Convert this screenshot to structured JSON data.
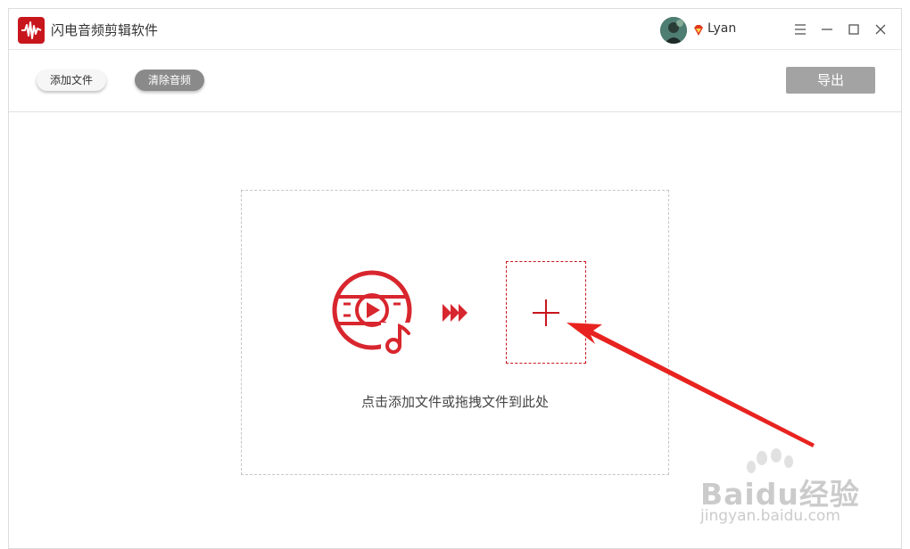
{
  "app": {
    "title": "闪电音频剪辑软件",
    "logo_icon": "waveform-logo-icon",
    "accent_color": "#c8161d"
  },
  "user": {
    "name": "Lyan",
    "avatar_icon": "user-avatar",
    "badge_icon": "vip-diamond-icon"
  },
  "window_controls": {
    "menu_icon": "menu-icon",
    "minimize_icon": "minimize-icon",
    "maximize_icon": "maximize-icon",
    "close_icon": "close-icon"
  },
  "toolbar": {
    "add_file_label": "添加文件",
    "clear_audio_label": "清除音频",
    "export_label": "导出"
  },
  "drop_zone": {
    "hint": "点击添加文件或拖拽文件到此处",
    "media_icon": "music-video-icon",
    "arrow_icon": "triple-chevron-right-icon",
    "add_icon": "plus-icon"
  },
  "watermark": {
    "brand": "Baidu经验",
    "url": "jingyan.baidu.com"
  }
}
